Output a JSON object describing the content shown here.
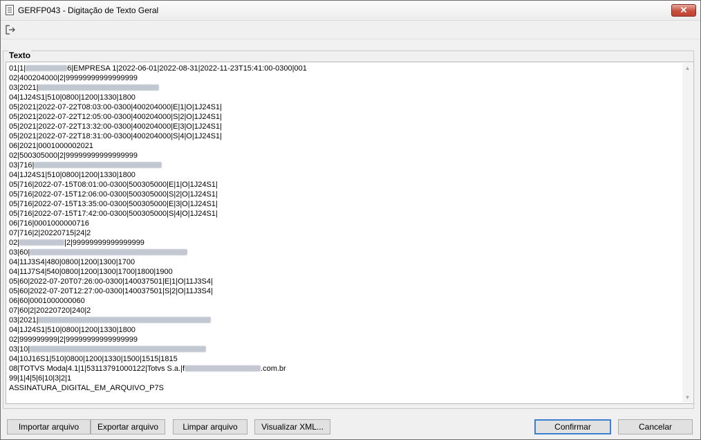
{
  "window": {
    "title": "GERFP043 - Digitação de Texto Geral",
    "close_symbol": "✕"
  },
  "group": {
    "label": "Texto"
  },
  "lines": [
    {
      "a": "01|1|",
      "r": 60,
      "b": "6|EMPRESA 1|2022-06-01|2022-08-31|2022-11-23T15:41:00-0300|001"
    },
    {
      "a": "02|400204000|2|99999999999999999",
      "r": 0,
      "b": ""
    },
    {
      "a": "03|2021|",
      "r": 175,
      "b": ""
    },
    {
      "a": "04|1J24S1|510|0800|1200|1330|1800",
      "r": 0,
      "b": ""
    },
    {
      "a": "05|2021|2022-07-22T08:03:00-0300|400204000|E|1|O|1J24S1|",
      "r": 0,
      "b": ""
    },
    {
      "a": "05|2021|2022-07-22T12:05:00-0300|400204000|S|2|O|1J24S1|",
      "r": 0,
      "b": ""
    },
    {
      "a": "05|2021|2022-07-22T13:32:00-0300|400204000|E|3|O|1J24S1|",
      "r": 0,
      "b": ""
    },
    {
      "a": "05|2021|2022-07-22T18:31:00-0300|400204000|S|4|O|1J24S1|",
      "r": 0,
      "b": ""
    },
    {
      "a": "06|2021|0001000002021",
      "r": 0,
      "b": ""
    },
    {
      "a": "02|500305000|2|99999999999999999",
      "r": 0,
      "b": ""
    },
    {
      "a": "03|716|",
      "r": 185,
      "b": ""
    },
    {
      "a": "04|1J24S1|510|0800|1200|1330|1800",
      "r": 0,
      "b": ""
    },
    {
      "a": "05|716|2022-07-15T08:01:00-0300|500305000|E|1|O|1J24S1|",
      "r": 0,
      "b": ""
    },
    {
      "a": "05|716|2022-07-15T12:06:00-0300|500305000|S|2|O|1J24S1|",
      "r": 0,
      "b": ""
    },
    {
      "a": "05|716|2022-07-15T13:35:00-0300|500305000|E|3|O|1J24S1|",
      "r": 0,
      "b": ""
    },
    {
      "a": "05|716|2022-07-15T17:42:00-0300|500305000|S|4|O|1J24S1|",
      "r": 0,
      "b": ""
    },
    {
      "a": "06|716|0001000000716",
      "r": 0,
      "b": ""
    },
    {
      "a": "07|716|2|20220715|24|2",
      "r": 0,
      "b": ""
    },
    {
      "a": "02|",
      "r": 65,
      "b": "|2|99999999999999999"
    },
    {
      "a": "03|60|",
      "r": 228,
      "b": ""
    },
    {
      "a": "04|11J3S4|480|0800|1200|1300|1700",
      "r": 0,
      "b": ""
    },
    {
      "a": "04|11J7S4|540|0800|1200|1300|1700|1800|1900",
      "r": 0,
      "b": ""
    },
    {
      "a": "05|60|2022-07-20T07:26:00-0300|140037501|E|1|O|11J3S4|",
      "r": 0,
      "b": ""
    },
    {
      "a": "05|60|2022-07-20T12:27:00-0300|140037501|S|2|O|11J3S4|",
      "r": 0,
      "b": ""
    },
    {
      "a": "06|60|0001000000060",
      "r": 0,
      "b": ""
    },
    {
      "a": "07|60|2|20220720|240|2",
      "r": 0,
      "b": ""
    },
    {
      "a": "03|2021|",
      "r": 250,
      "b": ""
    },
    {
      "a": "04|1J24S1|510|0800|1200|1330|1800",
      "r": 0,
      "b": ""
    },
    {
      "a": "02|999999999|2|99999999999999999",
      "r": 0,
      "b": ""
    },
    {
      "a": "03|10|",
      "r": 255,
      "b": ""
    },
    {
      "a": "04|10J16S1|510|0800|1200|1330|1500|1515|1815",
      "r": 0,
      "b": ""
    },
    {
      "a": "08|TOTVS Moda|4.1|1|53113791000122|Totvs S.a.|f",
      "r": 110,
      "b": ".com.br"
    },
    {
      "a": "99|1|4|5|6|10|3|2|1",
      "r": 0,
      "b": ""
    },
    {
      "a": "ASSINATURA_DIGITAL_EM_ARQUIVO_P7S",
      "r": 0,
      "b": ""
    }
  ],
  "buttons": {
    "import": "Importar arquivo",
    "export": "Exportar arquivo",
    "clear": "Limpar arquivo",
    "view_xml": "Visualizar XML...",
    "confirm": "Confirmar",
    "cancel": "Cancelar"
  }
}
